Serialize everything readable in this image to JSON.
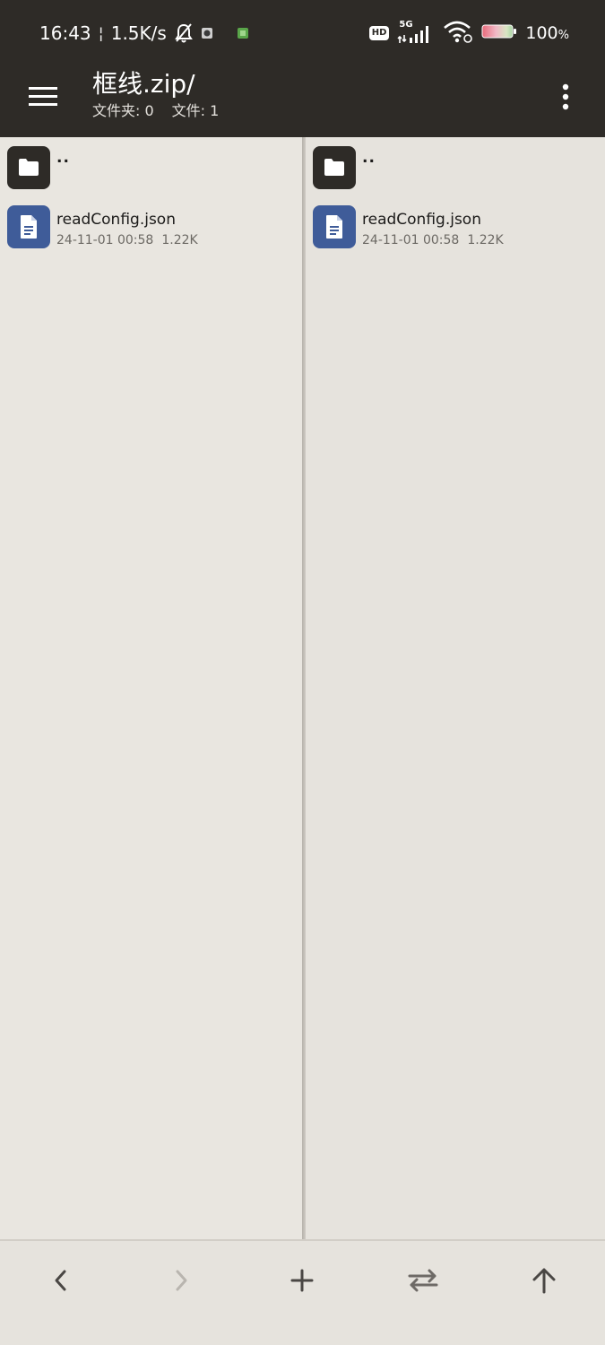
{
  "status_bar": {
    "time": "16:43",
    "separator": "¦",
    "net_speed": "1.5K/s",
    "icons": [
      "bell-off-icon",
      "app-notification-icon",
      "app-notification-green-icon",
      "hd-icon",
      "signal-5g-icon",
      "wifi-icon",
      "battery-icon"
    ],
    "hd_label": "HD",
    "network_label": "5G",
    "battery_value": "100",
    "battery_sign": "%"
  },
  "app_bar": {
    "title": "框线.zip/",
    "folders_label": "文件夹: 0",
    "files_label": "文件: 1",
    "menu_icon": "hamburger-menu-icon",
    "more_icon": "more-vert-icon"
  },
  "panes": {
    "left": {
      "parent": {
        "name": "..",
        "icon": "folder-icon"
      },
      "files": [
        {
          "name": "readConfig.json",
          "date": "24-11-01 00:58",
          "size": "1.22K",
          "icon": "document-icon"
        }
      ]
    },
    "right": {
      "parent": {
        "name": "..",
        "icon": "folder-icon"
      },
      "files": [
        {
          "name": "readConfig.json",
          "date": "24-11-01 00:58",
          "size": "1.22K",
          "icon": "document-icon"
        }
      ]
    }
  },
  "toolbar": {
    "buttons": [
      {
        "name": "back",
        "icon": "chevron-left-icon",
        "enabled": true
      },
      {
        "name": "forward",
        "icon": "chevron-right-icon",
        "enabled": false
      },
      {
        "name": "add",
        "icon": "plus-icon",
        "enabled": true
      },
      {
        "name": "swap",
        "icon": "swap-horizontal-icon",
        "enabled": true
      },
      {
        "name": "up",
        "icon": "arrow-up-icon",
        "enabled": true
      }
    ]
  },
  "colors": {
    "header_bg": "#2e2b27",
    "pane_bg": "#e9e6e0",
    "doc_icon": "#3f5c99",
    "folder_icon": "#2e2b27"
  }
}
